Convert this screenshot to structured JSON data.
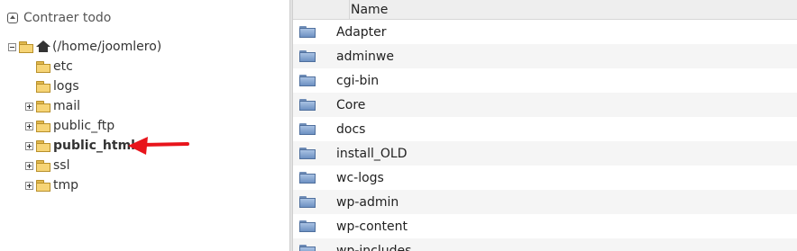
{
  "tree": {
    "collapse_label": "Contraer todo",
    "root_label": "(/home/joomlero)",
    "items": [
      {
        "label": "etc",
        "expandable": false
      },
      {
        "label": "logs",
        "expandable": false
      },
      {
        "label": "mail",
        "expandable": true
      },
      {
        "label": "public_ftp",
        "expandable": true
      },
      {
        "label": "public_html",
        "expandable": true,
        "bold": true
      },
      {
        "label": "ssl",
        "expandable": true
      },
      {
        "label": "tmp",
        "expandable": true
      }
    ]
  },
  "list": {
    "column_name": "Name",
    "rows": [
      "Adapter",
      "adminwe",
      "cgi-bin",
      "Core",
      "docs",
      "install_OLD",
      "wc-logs",
      "wp-admin",
      "wp-content",
      "wp-includes"
    ]
  },
  "colors": {
    "annotation_arrow": "#e8141b"
  }
}
